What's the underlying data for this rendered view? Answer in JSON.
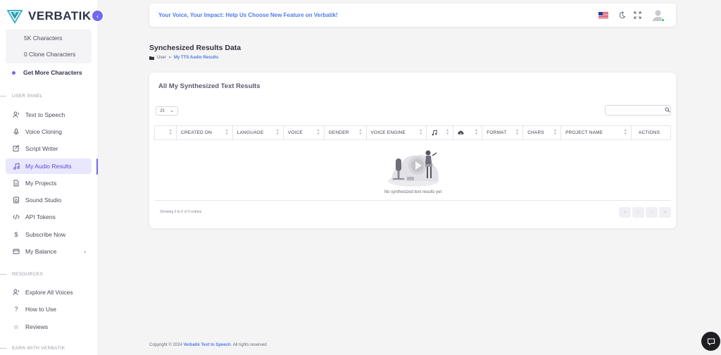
{
  "app": {
    "name": "VERBATIK"
  },
  "sidebar": {
    "characters": [
      "5K Characters",
      "0 Clone Characters"
    ],
    "get_more": "Get More Characters",
    "sections": [
      "USER PANEL",
      "RESOURCES",
      "EARN WITH VERBATIK"
    ],
    "user_panel_items": [
      {
        "label": "Text to Speech",
        "icon": "voice-icon"
      },
      {
        "label": "Voice Cloning",
        "icon": "microphone-icon"
      },
      {
        "label": "Script Writer",
        "icon": "edit-icon"
      },
      {
        "label": "My Audio Results",
        "icon": "music-note-icon",
        "active": true
      },
      {
        "label": "My Projects",
        "icon": "document-icon"
      },
      {
        "label": "Sound Studio",
        "icon": "headphones-icon"
      },
      {
        "label": "API Tokens",
        "icon": "code-icon"
      },
      {
        "label": "Subscribe Now",
        "icon": "dollar-icon"
      },
      {
        "label": "My Balance",
        "icon": "wallet-icon"
      }
    ],
    "resources_items": [
      {
        "label": "Explore All Voices",
        "icon": "voice-icon"
      },
      {
        "label": "How to Use",
        "icon": "question-icon"
      },
      {
        "label": "Reviews",
        "icon": "star-icon"
      }
    ]
  },
  "topbar": {
    "message": "Your Voice, Your Impact: Help Us Choose New Feature on Verbatik!"
  },
  "page": {
    "title": "Synchesized Results Data",
    "breadcrumb": {
      "parent": "User",
      "separator": "»",
      "current": "My TTS Audio Results"
    }
  },
  "card": {
    "title": "All My Synthesized Text Results",
    "page_size": "25",
    "search_placeholder": "",
    "columns": [
      "",
      "CREATED ON",
      "LANGUAGE",
      "VOICE",
      "GENDER",
      "VOICE ENGINE",
      "",
      "",
      "FORMAT",
      "CHARS",
      "PROJECT NAME",
      "ACTIONS"
    ],
    "empty_message": "No synthesized text results yet",
    "showing": "Showing 0 to 0 of 0 entries"
  },
  "footer": {
    "prefix": "Copyright © 2024 ",
    "brand": "Verbatik Text to Speech",
    "suffix": ". All rights reserved"
  },
  "colors": {
    "accent": "#7367f0",
    "link": "#4f7be8",
    "active_bg": "#e9e7fd"
  }
}
